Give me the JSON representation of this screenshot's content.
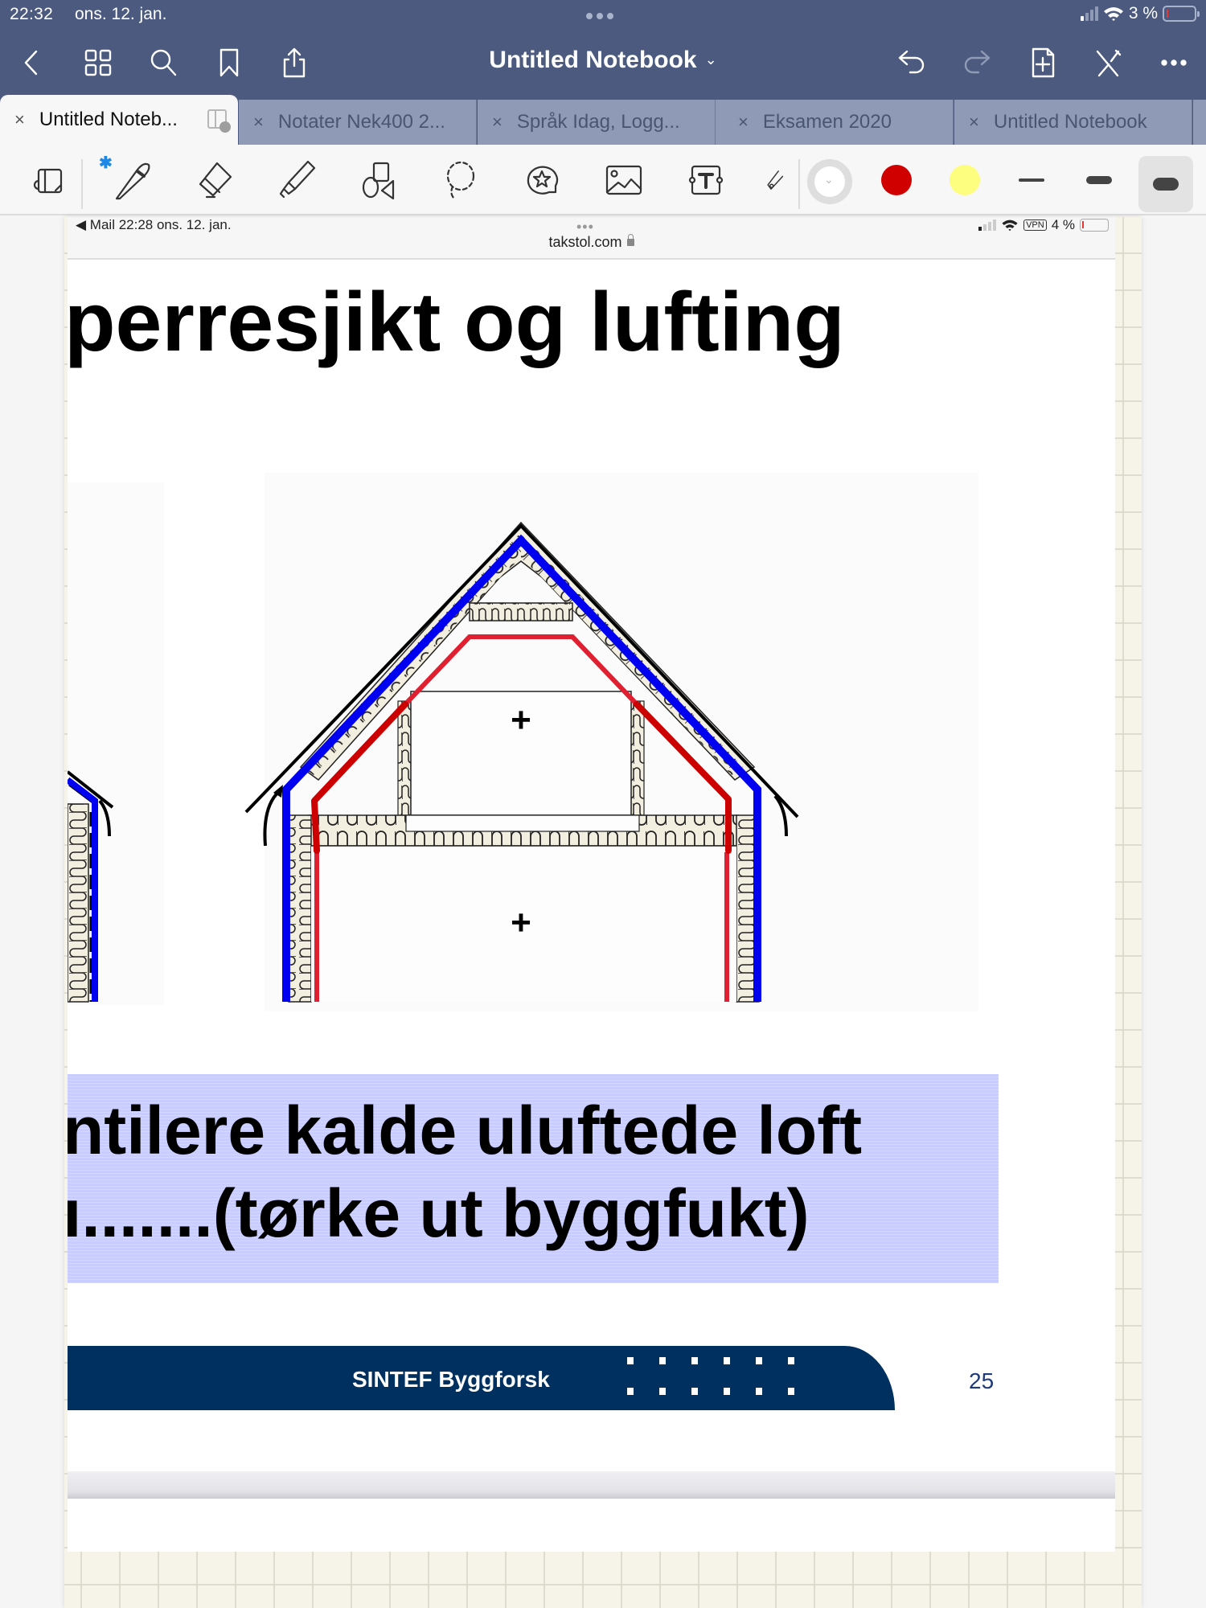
{
  "status_bar": {
    "time": "22:32",
    "date": "ons. 12. jan.",
    "battery": "3 %"
  },
  "nav": {
    "title": "Untitled Notebook",
    "title_chevron": "⌄",
    "icons": [
      "back-icon",
      "thumbnails-icon",
      "search-icon",
      "bookmark-icon",
      "share-icon",
      "undo-icon",
      "redo-icon",
      "add-page-icon",
      "pen-off-icon",
      "more-icon"
    ]
  },
  "tabs": [
    {
      "label": "Untitled Noteb...",
      "active": true
    },
    {
      "label": "Notater Nek400 2...",
      "active": false
    },
    {
      "label": "Språk Idag, Logg...",
      "active": false
    },
    {
      "label": "Eksamen 2020",
      "active": false
    },
    {
      "label": "Untitled Notebook",
      "active": false
    }
  ],
  "tab_close": "×",
  "toolbar": {
    "tools": [
      "read-mode",
      "pen",
      "eraser",
      "highlighter",
      "shapes",
      "lasso",
      "stickers",
      "image",
      "text",
      "laser-pointer"
    ],
    "bluetooth": "✱",
    "colors": {
      "current": "#ffffff",
      "red": "#d10000",
      "yellow": "#fdfd80"
    },
    "stroke_widths": [
      "thin",
      "medium",
      "thick"
    ],
    "selected_stroke": "thick"
  },
  "screenshot": {
    "status": {
      "left": "◀ Mail   22:28   ons. 12. jan.",
      "dots": "•••",
      "url": "takstol.com",
      "vpn": "VPN",
      "battery": "4 %"
    },
    "slide_title": "perresjikt og lufting",
    "diagram": {
      "room_markers": [
        "+",
        "+"
      ],
      "colors": {
        "wind_barrier": "#0000f0",
        "vapor_barrier": "#e02030",
        "vapor_barrier_drawn": "#cc0000",
        "insulation": "#f2eee0"
      }
    },
    "callout": {
      "line1": "ntilere kalde uluftede loft",
      "line2": "ı.......(tørke ut byggfukt)",
      "color": "#c8ccff"
    },
    "footer": {
      "brand": "SINTEF Byggforsk",
      "page_number": "25",
      "color": "#003060"
    }
  }
}
